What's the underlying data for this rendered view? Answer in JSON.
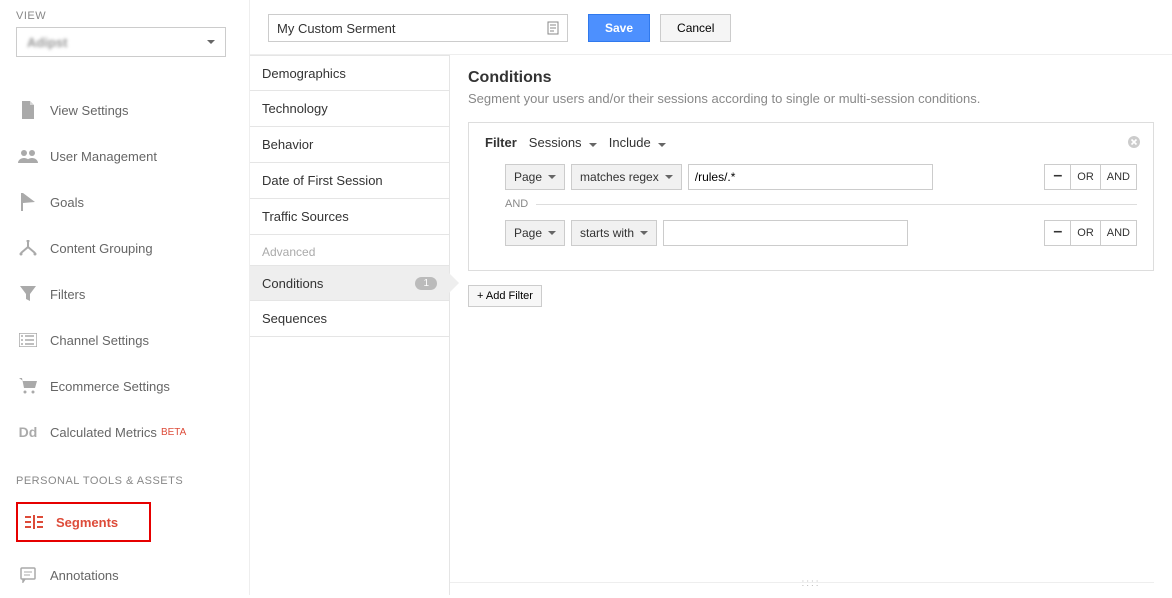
{
  "sidebar": {
    "view_label": "VIEW",
    "view_value": "Adipst",
    "nav": [
      {
        "label": "View Settings"
      },
      {
        "label": "User Management"
      },
      {
        "label": "Goals"
      },
      {
        "label": "Content Grouping"
      },
      {
        "label": "Filters"
      },
      {
        "label": "Channel Settings"
      },
      {
        "label": "Ecommerce Settings"
      },
      {
        "label": "Calculated Metrics",
        "beta": "BETA"
      }
    ],
    "section_head": "PERSONAL TOOLS & ASSETS",
    "personal": [
      {
        "label": "Segments",
        "active": true
      },
      {
        "label": "Annotations"
      }
    ]
  },
  "mid": {
    "items": [
      {
        "label": "Demographics"
      },
      {
        "label": "Technology"
      },
      {
        "label": "Behavior"
      },
      {
        "label": "Date of First Session"
      },
      {
        "label": "Traffic Sources"
      }
    ],
    "adv_label": "Advanced",
    "adv_items": [
      {
        "label": "Conditions",
        "badge": "1",
        "active": true
      },
      {
        "label": "Sequences"
      }
    ]
  },
  "main": {
    "segment_name": "My Custom Serment",
    "save": "Save",
    "cancel": "Cancel",
    "title": "Conditions",
    "desc": "Segment your users and/or their sessions according to single or multi-session conditions.",
    "filter": {
      "filter_label": "Filter",
      "scope": "Sessions",
      "mode": "Include",
      "rows": [
        {
          "dim": "Page",
          "op": "matches regex",
          "val": "/rules/.*"
        },
        {
          "dim": "Page",
          "op": "starts with",
          "val": ""
        }
      ],
      "and_sep": "AND",
      "or_label": "OR",
      "and_label": "AND",
      "minus": "–"
    },
    "add_filter": "+ Add Filter"
  }
}
